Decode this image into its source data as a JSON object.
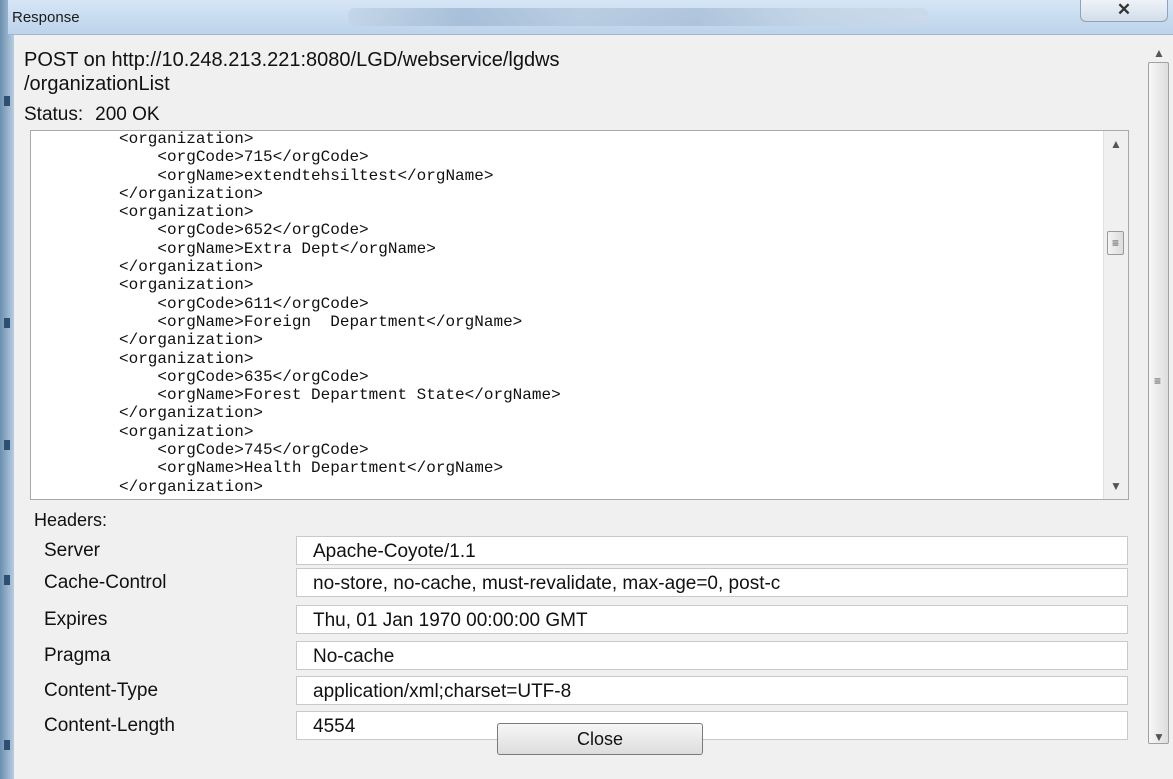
{
  "window": {
    "title": "Response",
    "close_label": "✕"
  },
  "request": {
    "line1": "POST on http://10.248.213.221:8080/LGD/webservice/lgdws",
    "line2": "/organizationList",
    "status_label": "Status:",
    "status_value": "200 OK"
  },
  "xml_lines": [
    "<organization>",
    "    <orgCode>715</orgCode>",
    "    <orgName>extendtehsiltest</orgName>",
    "</organization>",
    "<organization>",
    "    <orgCode>652</orgCode>",
    "    <orgName>Extra Dept</orgName>",
    "</organization>",
    "<organization>",
    "    <orgCode>611</orgCode>",
    "    <orgName>Foreign  Department</orgName>",
    "</organization>",
    "<organization>",
    "    <orgCode>635</orgCode>",
    "    <orgName>Forest Department State</orgName>",
    "</organization>",
    "<organization>",
    "    <orgCode>745</orgCode>",
    "    <orgName>Health Department</orgName>",
    "</organization>"
  ],
  "headers": {
    "label": "Headers:",
    "rows": [
      {
        "name": "Server",
        "value": "Apache-Coyote/1.1"
      },
      {
        "name": "Cache-Control",
        "value": "no-store, no-cache, must-revalidate, max-age=0, post-c"
      },
      {
        "name": "Expires",
        "value": "Thu, 01 Jan 1970 00:00:00 GMT"
      },
      {
        "name": "Pragma",
        "value": "No-cache"
      },
      {
        "name": "Content-Type",
        "value": "application/xml;charset=UTF-8"
      },
      {
        "name": "Content-Length",
        "value": "4554"
      }
    ]
  },
  "buttons": {
    "close": "Close"
  },
  "colors": {
    "title_bar": "#bcd3ea",
    "dialog_bg": "#f0f0f0"
  }
}
